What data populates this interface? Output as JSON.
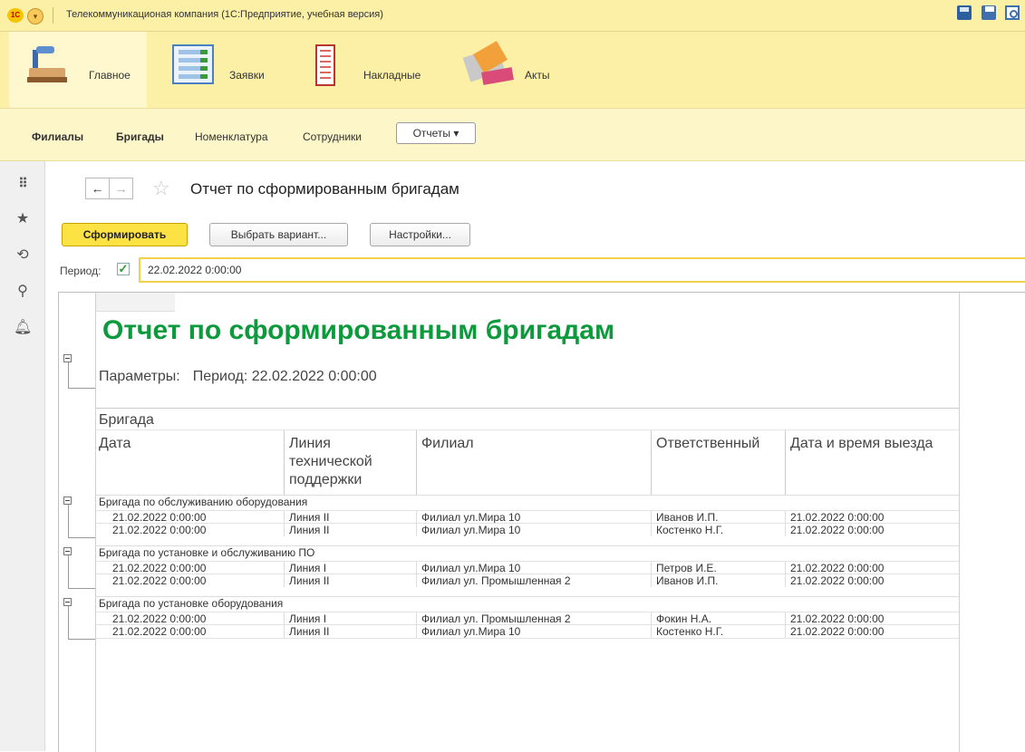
{
  "window": {
    "title": "Телекоммуникационая компания  (1С:Предприятие, учебная версия)",
    "logo_text": "1С"
  },
  "sections": [
    {
      "label": "Главное",
      "icon": "desk-lamp-icon"
    },
    {
      "label": "Заявки",
      "icon": "checklist-icon"
    },
    {
      "label": "Накладные",
      "icon": "invoice-icon"
    },
    {
      "label": "Акты",
      "icon": "documents-stack-icon"
    }
  ],
  "subnav": {
    "items": [
      "Филиалы",
      "Бригады",
      "Номенклатура",
      "Сотрудники"
    ],
    "reports_label": "Отчеты ▾"
  },
  "left_tools": [
    "apps-grid-icon",
    "favorites-star-icon",
    "history-icon",
    "search-icon",
    "notifications-bell-icon"
  ],
  "form": {
    "back": "←",
    "forward": "→",
    "favorite": "☆",
    "title": "Отчет по сформированным бригадам",
    "buttons": {
      "generate": "Сформировать",
      "choose_variant": "Выбрать вариант...",
      "settings": "Настройки..."
    },
    "period_label": "Период:",
    "period_checked": "✓",
    "period_value": "22.02.2022  0:00:00"
  },
  "report": {
    "title": "Отчет по сформированным бригадам",
    "params_label": "Параметры:",
    "params_value": "Период: 22.02.2022 0:00:00",
    "header": {
      "group": "Бригада",
      "columns": [
        "Дата",
        "Линия технической поддержки",
        "Филиал",
        "Ответственный",
        "Дата и время выезда"
      ]
    },
    "groups": [
      {
        "name": "Бригада по обслуживанию оборудования",
        "rows": [
          [
            "21.02.2022 0:00:00",
            "Линия II",
            "Филиал ул.Мира 10",
            "Иванов И.П.",
            "21.02.2022 0:00:00"
          ],
          [
            "21.02.2022 0:00:00",
            "Линия II",
            "Филиал ул.Мира 10",
            "Костенко Н.Г.",
            "21.02.2022 0:00:00"
          ]
        ]
      },
      {
        "name": "Бригада по установке и обслуживанию ПО",
        "rows": [
          [
            "21.02.2022 0:00:00",
            "Линия I",
            "Филиал ул.Мира 10",
            "Петров И.Е.",
            "21.02.2022 0:00:00"
          ],
          [
            "21.02.2022 0:00:00",
            "Линия II",
            "Филиал ул. Промышленная 2",
            "Иванов И.П.",
            "21.02.2022 0:00:00"
          ]
        ]
      },
      {
        "name": "Бригада по установке оборудования",
        "rows": [
          [
            "21.02.2022 0:00:00",
            "Линия I",
            "Филиал ул. Промышленная 2",
            "Фокин Н.А.",
            "21.02.2022 0:00:00"
          ],
          [
            "21.02.2022 0:00:00",
            "Линия II",
            "Филиал ул.Мира 10",
            "Костенко Н.Г.",
            "21.02.2022 0:00:00"
          ]
        ]
      }
    ]
  }
}
